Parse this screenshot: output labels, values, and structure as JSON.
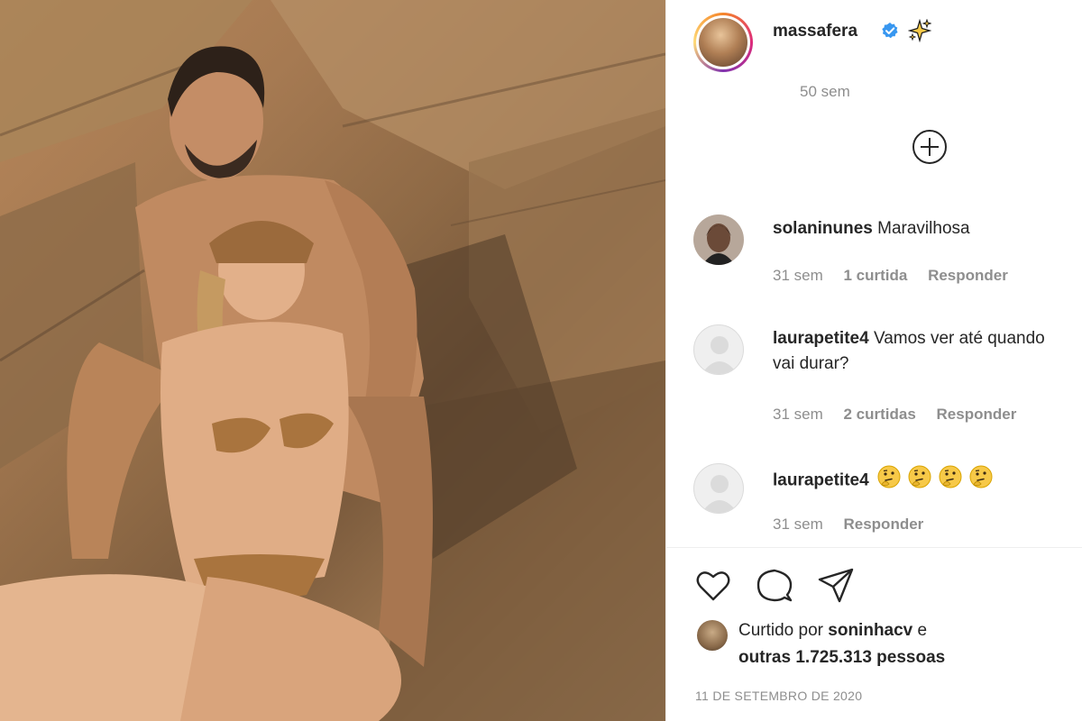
{
  "post": {
    "owner": "massafera",
    "owner_verified": true,
    "owner_emoji_icon": "sparkles-icon",
    "time": "50 sem",
    "photo_description_icon": "photo-content"
  },
  "load_more": {
    "icon": "plus-circle-icon"
  },
  "comments": [
    {
      "user": "solaninunes",
      "text": "Maravilhosa",
      "time": "31 sem",
      "likes": "1 curtida",
      "reply": "Responder"
    },
    {
      "user": "laurapetite4",
      "text": "Vamos ver até quando vai durar?",
      "time": "31 sem",
      "likes": "2 curtidas",
      "reply": "Responder"
    },
    {
      "user": "laurapetite4",
      "text": "",
      "emoji": [
        "thinking-face",
        "thinking-face",
        "thinking-face",
        "thinking-face"
      ],
      "time": "31 sem",
      "reply": "Responder"
    }
  ],
  "actions": {
    "like_icon": "heart-icon",
    "comment_icon": "comment-bubble-icon",
    "share_icon": "paper-plane-icon"
  },
  "likes": {
    "prefix": "Curtido por",
    "user": "soninhacv",
    "joiner": "e",
    "others_prefix": "outras",
    "others_count": "1.725.313",
    "others_suffix": "pessoas"
  },
  "date": "11 DE SETEMBRO DE 2020",
  "colors": {
    "text": "#262626",
    "muted": "#8e8e8e",
    "verified": "#3897f0",
    "divider": "#efefef"
  }
}
